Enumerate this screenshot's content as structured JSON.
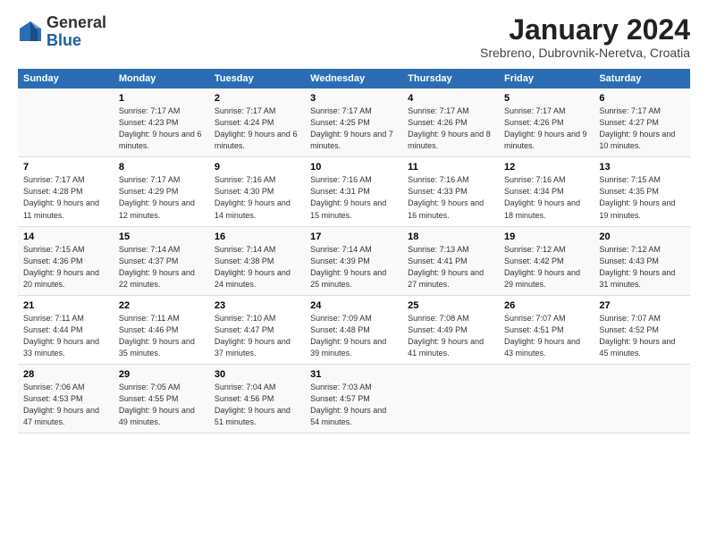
{
  "logo": {
    "general": "General",
    "blue": "Blue"
  },
  "header": {
    "month": "January 2024",
    "location": "Srebreno, Dubrovnik-Neretva, Croatia"
  },
  "weekdays": [
    "Sunday",
    "Monday",
    "Tuesday",
    "Wednesday",
    "Thursday",
    "Friday",
    "Saturday"
  ],
  "weeks": [
    [
      {
        "day": "",
        "sunrise": "",
        "sunset": "",
        "daylight": ""
      },
      {
        "day": "1",
        "sunrise": "Sunrise: 7:17 AM",
        "sunset": "Sunset: 4:23 PM",
        "daylight": "Daylight: 9 hours and 6 minutes."
      },
      {
        "day": "2",
        "sunrise": "Sunrise: 7:17 AM",
        "sunset": "Sunset: 4:24 PM",
        "daylight": "Daylight: 9 hours and 6 minutes."
      },
      {
        "day": "3",
        "sunrise": "Sunrise: 7:17 AM",
        "sunset": "Sunset: 4:25 PM",
        "daylight": "Daylight: 9 hours and 7 minutes."
      },
      {
        "day": "4",
        "sunrise": "Sunrise: 7:17 AM",
        "sunset": "Sunset: 4:26 PM",
        "daylight": "Daylight: 9 hours and 8 minutes."
      },
      {
        "day": "5",
        "sunrise": "Sunrise: 7:17 AM",
        "sunset": "Sunset: 4:26 PM",
        "daylight": "Daylight: 9 hours and 9 minutes."
      },
      {
        "day": "6",
        "sunrise": "Sunrise: 7:17 AM",
        "sunset": "Sunset: 4:27 PM",
        "daylight": "Daylight: 9 hours and 10 minutes."
      }
    ],
    [
      {
        "day": "7",
        "sunrise": "Sunrise: 7:17 AM",
        "sunset": "Sunset: 4:28 PM",
        "daylight": "Daylight: 9 hours and 11 minutes."
      },
      {
        "day": "8",
        "sunrise": "Sunrise: 7:17 AM",
        "sunset": "Sunset: 4:29 PM",
        "daylight": "Daylight: 9 hours and 12 minutes."
      },
      {
        "day": "9",
        "sunrise": "Sunrise: 7:16 AM",
        "sunset": "Sunset: 4:30 PM",
        "daylight": "Daylight: 9 hours and 14 minutes."
      },
      {
        "day": "10",
        "sunrise": "Sunrise: 7:16 AM",
        "sunset": "Sunset: 4:31 PM",
        "daylight": "Daylight: 9 hours and 15 minutes."
      },
      {
        "day": "11",
        "sunrise": "Sunrise: 7:16 AM",
        "sunset": "Sunset: 4:33 PM",
        "daylight": "Daylight: 9 hours and 16 minutes."
      },
      {
        "day": "12",
        "sunrise": "Sunrise: 7:16 AM",
        "sunset": "Sunset: 4:34 PM",
        "daylight": "Daylight: 9 hours and 18 minutes."
      },
      {
        "day": "13",
        "sunrise": "Sunrise: 7:15 AM",
        "sunset": "Sunset: 4:35 PM",
        "daylight": "Daylight: 9 hours and 19 minutes."
      }
    ],
    [
      {
        "day": "14",
        "sunrise": "Sunrise: 7:15 AM",
        "sunset": "Sunset: 4:36 PM",
        "daylight": "Daylight: 9 hours and 20 minutes."
      },
      {
        "day": "15",
        "sunrise": "Sunrise: 7:14 AM",
        "sunset": "Sunset: 4:37 PM",
        "daylight": "Daylight: 9 hours and 22 minutes."
      },
      {
        "day": "16",
        "sunrise": "Sunrise: 7:14 AM",
        "sunset": "Sunset: 4:38 PM",
        "daylight": "Daylight: 9 hours and 24 minutes."
      },
      {
        "day": "17",
        "sunrise": "Sunrise: 7:14 AM",
        "sunset": "Sunset: 4:39 PM",
        "daylight": "Daylight: 9 hours and 25 minutes."
      },
      {
        "day": "18",
        "sunrise": "Sunrise: 7:13 AM",
        "sunset": "Sunset: 4:41 PM",
        "daylight": "Daylight: 9 hours and 27 minutes."
      },
      {
        "day": "19",
        "sunrise": "Sunrise: 7:12 AM",
        "sunset": "Sunset: 4:42 PM",
        "daylight": "Daylight: 9 hours and 29 minutes."
      },
      {
        "day": "20",
        "sunrise": "Sunrise: 7:12 AM",
        "sunset": "Sunset: 4:43 PM",
        "daylight": "Daylight: 9 hours and 31 minutes."
      }
    ],
    [
      {
        "day": "21",
        "sunrise": "Sunrise: 7:11 AM",
        "sunset": "Sunset: 4:44 PM",
        "daylight": "Daylight: 9 hours and 33 minutes."
      },
      {
        "day": "22",
        "sunrise": "Sunrise: 7:11 AM",
        "sunset": "Sunset: 4:46 PM",
        "daylight": "Daylight: 9 hours and 35 minutes."
      },
      {
        "day": "23",
        "sunrise": "Sunrise: 7:10 AM",
        "sunset": "Sunset: 4:47 PM",
        "daylight": "Daylight: 9 hours and 37 minutes."
      },
      {
        "day": "24",
        "sunrise": "Sunrise: 7:09 AM",
        "sunset": "Sunset: 4:48 PM",
        "daylight": "Daylight: 9 hours and 39 minutes."
      },
      {
        "day": "25",
        "sunrise": "Sunrise: 7:08 AM",
        "sunset": "Sunset: 4:49 PM",
        "daylight": "Daylight: 9 hours and 41 minutes."
      },
      {
        "day": "26",
        "sunrise": "Sunrise: 7:07 AM",
        "sunset": "Sunset: 4:51 PM",
        "daylight": "Daylight: 9 hours and 43 minutes."
      },
      {
        "day": "27",
        "sunrise": "Sunrise: 7:07 AM",
        "sunset": "Sunset: 4:52 PM",
        "daylight": "Daylight: 9 hours and 45 minutes."
      }
    ],
    [
      {
        "day": "28",
        "sunrise": "Sunrise: 7:06 AM",
        "sunset": "Sunset: 4:53 PM",
        "daylight": "Daylight: 9 hours and 47 minutes."
      },
      {
        "day": "29",
        "sunrise": "Sunrise: 7:05 AM",
        "sunset": "Sunset: 4:55 PM",
        "daylight": "Daylight: 9 hours and 49 minutes."
      },
      {
        "day": "30",
        "sunrise": "Sunrise: 7:04 AM",
        "sunset": "Sunset: 4:56 PM",
        "daylight": "Daylight: 9 hours and 51 minutes."
      },
      {
        "day": "31",
        "sunrise": "Sunrise: 7:03 AM",
        "sunset": "Sunset: 4:57 PM",
        "daylight": "Daylight: 9 hours and 54 minutes."
      },
      {
        "day": "",
        "sunrise": "",
        "sunset": "",
        "daylight": ""
      },
      {
        "day": "",
        "sunrise": "",
        "sunset": "",
        "daylight": ""
      },
      {
        "day": "",
        "sunrise": "",
        "sunset": "",
        "daylight": ""
      }
    ]
  ]
}
